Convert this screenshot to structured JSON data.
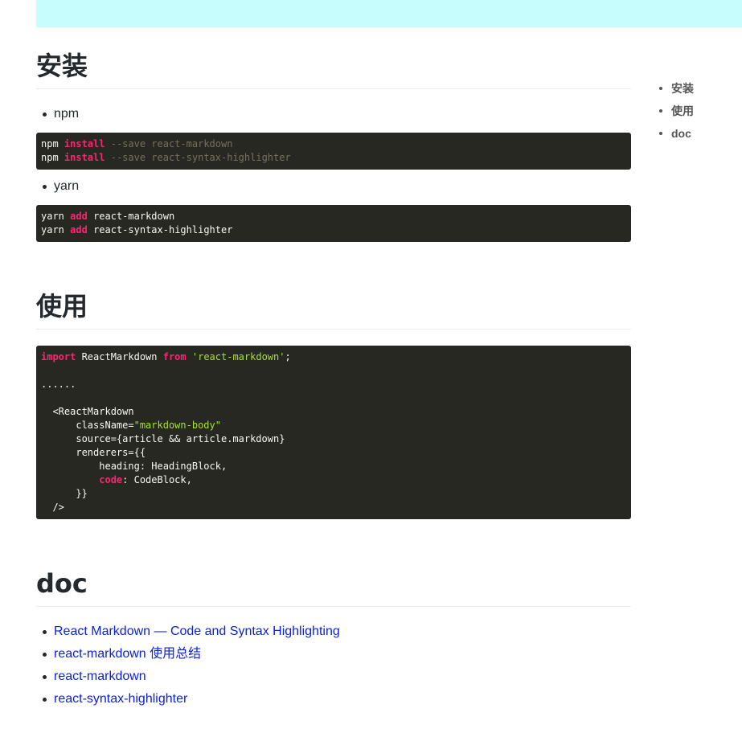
{
  "sections": {
    "install": {
      "title": "安装",
      "npm_label": "npm",
      "npm_code": [
        {
          "cmd": "npm",
          "kw": "install",
          "rest": "--save react-markdown"
        },
        {
          "cmd": "npm",
          "kw": "install",
          "rest": "--save react-syntax-highlighter"
        }
      ],
      "yarn_label": "yarn",
      "yarn_code": [
        {
          "cmd": "yarn",
          "kw": "add",
          "rest": "react-markdown"
        },
        {
          "cmd": "yarn",
          "kw": "add",
          "rest": "react-syntax-highlighter"
        }
      ]
    },
    "usage": {
      "title": "使用",
      "code": {
        "l1_kw1": "import",
        "l1_mid": " ReactMarkdown ",
        "l1_kw2": "from",
        "l1_str": "'react-markdown'",
        "l1_end": ";",
        "l2": "......",
        "l3": "  <ReactMarkdown",
        "l4_a": "      className=",
        "l4_str": "\"markdown-body\"",
        "l5": "      source={article && article.markdown}",
        "l6": "      renderers={{",
        "l7": "          heading: HeadingBlock,",
        "l8_kw": "code",
        "l8_rest": ": CodeBlock,",
        "l9": "      }}",
        "l10": "  />"
      }
    },
    "doc": {
      "title": "doc",
      "links": [
        "React Markdown — Code and Syntax Highlighting",
        "react-markdown 使用总结",
        "react-markdown",
        "react-syntax-highlighter"
      ]
    }
  },
  "toc": [
    "安装",
    "使用",
    "doc"
  ],
  "colors": {
    "banner": "#c8fdfe",
    "code_bg": "#272822",
    "keyword": "#f92672",
    "string": "#a6e22e",
    "comment": "#75715e",
    "link": "#0d22d8"
  }
}
